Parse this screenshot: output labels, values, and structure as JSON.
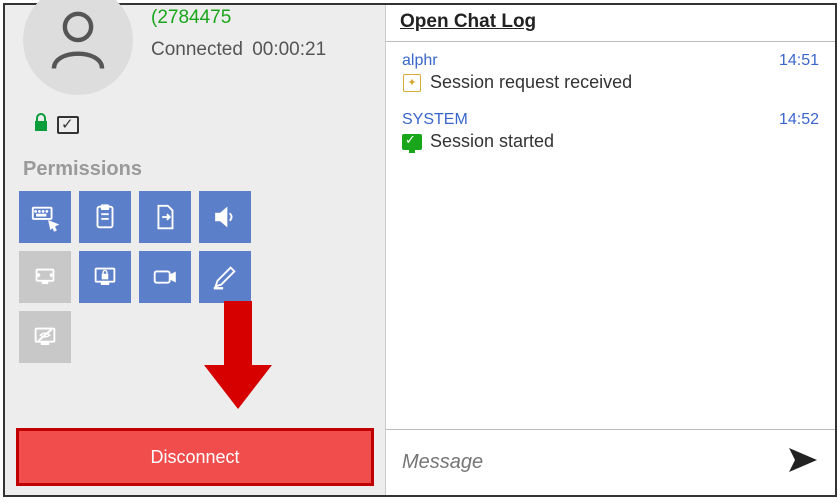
{
  "profile": {
    "session_id": "(2784475",
    "connected_label": "Connected",
    "duration": "00:00:21"
  },
  "status": {
    "lock_icon": "lock-icon",
    "monitor_icon": "monitor-check-icon"
  },
  "permissions": {
    "label": "Permissions",
    "items": [
      {
        "name": "keyboard-mouse",
        "enabled": true
      },
      {
        "name": "clipboard",
        "enabled": true
      },
      {
        "name": "file-transfer",
        "enabled": true
      },
      {
        "name": "audio",
        "enabled": true
      },
      {
        "name": "switch-sides",
        "enabled": false
      },
      {
        "name": "lock-desk",
        "enabled": true
      },
      {
        "name": "record",
        "enabled": true
      },
      {
        "name": "whiteboard",
        "enabled": true
      },
      {
        "name": "privacy-screen",
        "enabled": false
      }
    ]
  },
  "disconnect_label": "Disconnect",
  "chat": {
    "header": "Open Chat Log",
    "entries": [
      {
        "name": "alphr",
        "time": "14:51",
        "text": "Session request received",
        "icon": "badge"
      },
      {
        "name": "SYSTEM",
        "time": "14:52",
        "text": "Session started",
        "icon": "monitor-ok"
      }
    ],
    "input_placeholder": "Message"
  },
  "colors": {
    "accent_blue": "#5c7fc9",
    "disabled_gray": "#c8c8c8",
    "disconnect_red": "#f24d4d",
    "arrow_red": "#d60000",
    "link_blue": "#3a66cc",
    "green": "#1aa61a"
  }
}
